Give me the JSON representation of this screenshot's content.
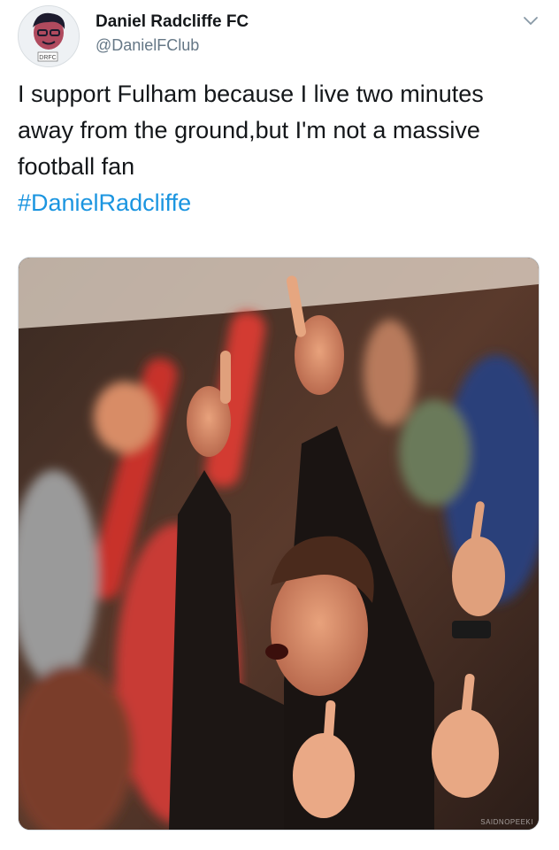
{
  "account": {
    "display_name": "Daniel Radcliffe FC",
    "handle": "@DanielFClub",
    "avatar_badge": "DRFC"
  },
  "tweet": {
    "text": "I support Fulham because I live two minutes away from the ground,but I'm not a massive football fan",
    "hashtag": "#DanielRadcliffe"
  },
  "media": {
    "description_icon": "photo-crowd-cheering",
    "watermark": "SAIDNOPEEKI"
  },
  "colors": {
    "hashtag": "#1b95e0",
    "handle": "#657786",
    "text": "#14171a"
  }
}
